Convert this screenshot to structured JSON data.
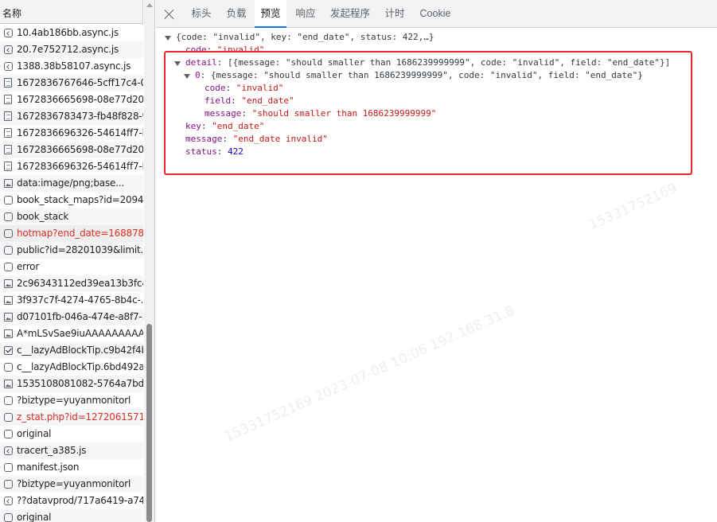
{
  "list": {
    "header": "名称",
    "rows": [
      {
        "name": "10.4ab186bb.async.js",
        "icon": "script-icon"
      },
      {
        "name": "20.7e752712.async.js",
        "icon": "script-icon"
      },
      {
        "name": "1388.38b58107.async.js",
        "icon": "script-icon"
      },
      {
        "name": "1672836767646-5cff17c4-0...",
        "icon": "document-icon"
      },
      {
        "name": "1672836665698-08e77d20-...",
        "icon": "document-icon"
      },
      {
        "name": "1672836783473-fb48f828-9...",
        "icon": "document-icon"
      },
      {
        "name": "1672836696326-54614ff7-b...",
        "icon": "document-icon"
      },
      {
        "name": "1672836665698-08e77d20-...",
        "icon": "document-icon"
      },
      {
        "name": "1672836696326-54614ff7-b...",
        "icon": "document-icon"
      },
      {
        "name": "data:image/png;base...",
        "icon": "image-icon"
      },
      {
        "name": "book_stack_maps?id=2094...",
        "icon": "fetch-icon"
      },
      {
        "name": "book_stack",
        "icon": "fetch-icon"
      },
      {
        "name": "hotmap?end_date=168878...",
        "icon": "fetch-icon",
        "status": "error",
        "selected": true
      },
      {
        "name": "public?id=28201039&limit...",
        "icon": "fetch-icon"
      },
      {
        "name": "error",
        "icon": "fetch-icon"
      },
      {
        "name": "2c96343112ed39ea13b3fc4...",
        "icon": "image-icon"
      },
      {
        "name": "3f937c7f-4274-4765-8b4c-...",
        "icon": "image-icon"
      },
      {
        "name": "d07101fb-046a-474e-a8f7-...",
        "icon": "image-icon"
      },
      {
        "name": "A*mLSvSae9iuAAAAAAAAA...",
        "icon": "image-icon"
      },
      {
        "name": "c__lazyAdBlockTip.c9b42f4b...",
        "icon": "checkbox-icon"
      },
      {
        "name": "c__lazyAdBlockTip.6bd492a...",
        "icon": "fetch-icon"
      },
      {
        "name": "1535108081082-5764a7bd-...",
        "icon": "image-icon"
      },
      {
        "name": "?biztype=yuyanmonitorl",
        "icon": "fetch-icon"
      },
      {
        "name": "z_stat.php?id=1272061571...",
        "icon": "fetch-icon",
        "status": "error"
      },
      {
        "name": "original",
        "icon": "fetch-icon"
      },
      {
        "name": "tracert_a385.js",
        "icon": "script-icon"
      },
      {
        "name": "manifest.json",
        "icon": "fetch-icon"
      },
      {
        "name": "?biztype=yuyanmonitorl",
        "icon": "fetch-icon"
      },
      {
        "name": "??datavprod/717a6419-a74...",
        "icon": "script-icon"
      },
      {
        "name": "original",
        "icon": "fetch-icon"
      }
    ]
  },
  "tabs": [
    {
      "label": "标头"
    },
    {
      "label": "负载"
    },
    {
      "label": "预览",
      "active": true
    },
    {
      "label": "响应"
    },
    {
      "label": "发起程序"
    },
    {
      "label": "计时"
    },
    {
      "label": "Cookie"
    }
  ],
  "preview": {
    "summary": "{code: \"invalid\", key: \"end_date\", status: 422,…}",
    "code_key": "code",
    "code_val": "\"invalid\"",
    "detail_key": "detail",
    "detail_val": "[{message: \"should smaller than 1686239999999\", code: \"invalid\", field: \"end_date\"}]",
    "item_key": "0",
    "item_val": "{message: \"should smaller than 1686239999999\", code: \"invalid\", field: \"end_date\"}",
    "item_code_key": "code",
    "item_code_val": "\"invalid\"",
    "item_field_key": "field",
    "item_field_val": "\"end_date\"",
    "item_message_key": "message",
    "item_message_val": "\"should smaller than 1686239999999\"",
    "key_key": "key",
    "key_val": "\"end_date\"",
    "message_key": "message",
    "message_val": "\"end_date invalid\"",
    "status_key": "status",
    "status_val": "422"
  },
  "watermark": {
    "text1": "15331752169  2023-07-08  10:06  192.168.31.8",
    "text2": "15331752169"
  },
  "colors": {
    "highlight": "#e8262b",
    "error_text": "#d93025",
    "active_tab": "#1a73e8"
  }
}
